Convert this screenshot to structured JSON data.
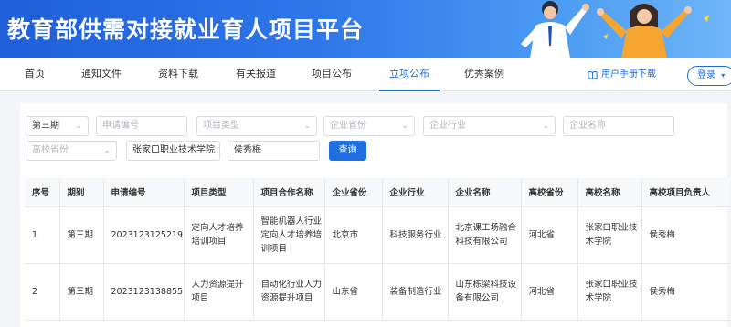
{
  "banner": {
    "title": "教育部供需对接就业育人项目平台"
  },
  "nav": {
    "items": [
      "首页",
      "通知文件",
      "资料下载",
      "有关报道",
      "项目公布",
      "立项公布",
      "优秀案例"
    ],
    "active_index": 5,
    "manual": "用户手册下载",
    "login": "登录"
  },
  "filters": {
    "period": "第三期",
    "application_no_placeholder": "申请编号",
    "project_type_placeholder": "项目类型",
    "company_province_placeholder": "企业省份",
    "industry_placeholder": "企业行业",
    "company_name_placeholder": "企业名称",
    "school_province_placeholder": "高校省份",
    "school_name": "张家口职业技术学院",
    "leader": "侯秀梅",
    "query_label": "查询"
  },
  "table": {
    "headers": [
      "序号",
      "期别",
      "申请编号",
      "项目类型",
      "项目合作名称",
      "企业省份",
      "企业行业",
      "企业名称",
      "高校省份",
      "高校名称",
      "高校项目负责人"
    ],
    "rows": [
      [
        "1",
        "第三期",
        "2023123125219",
        "定向人才培养培训项目",
        "智能机器人行业定向人才培养培训项目",
        "北京市",
        "科技服务行业",
        "北京课工场融合科技有限公司",
        "河北省",
        "张家口职业技术学院",
        "侯秀梅"
      ],
      [
        "2",
        "第三期",
        "2023123138855",
        "人力资源提升项目",
        "自动化行业人力资源提升项目",
        "山东省",
        "装备制造行业",
        "山东栋梁科技设备有限公司",
        "河北省",
        "张家口职业技术学院",
        "侯秀梅"
      ]
    ]
  },
  "colors": {
    "brand": "#1f6fe0",
    "banner_start": "#1f5fd9",
    "banner_end": "#6fb6f8"
  }
}
